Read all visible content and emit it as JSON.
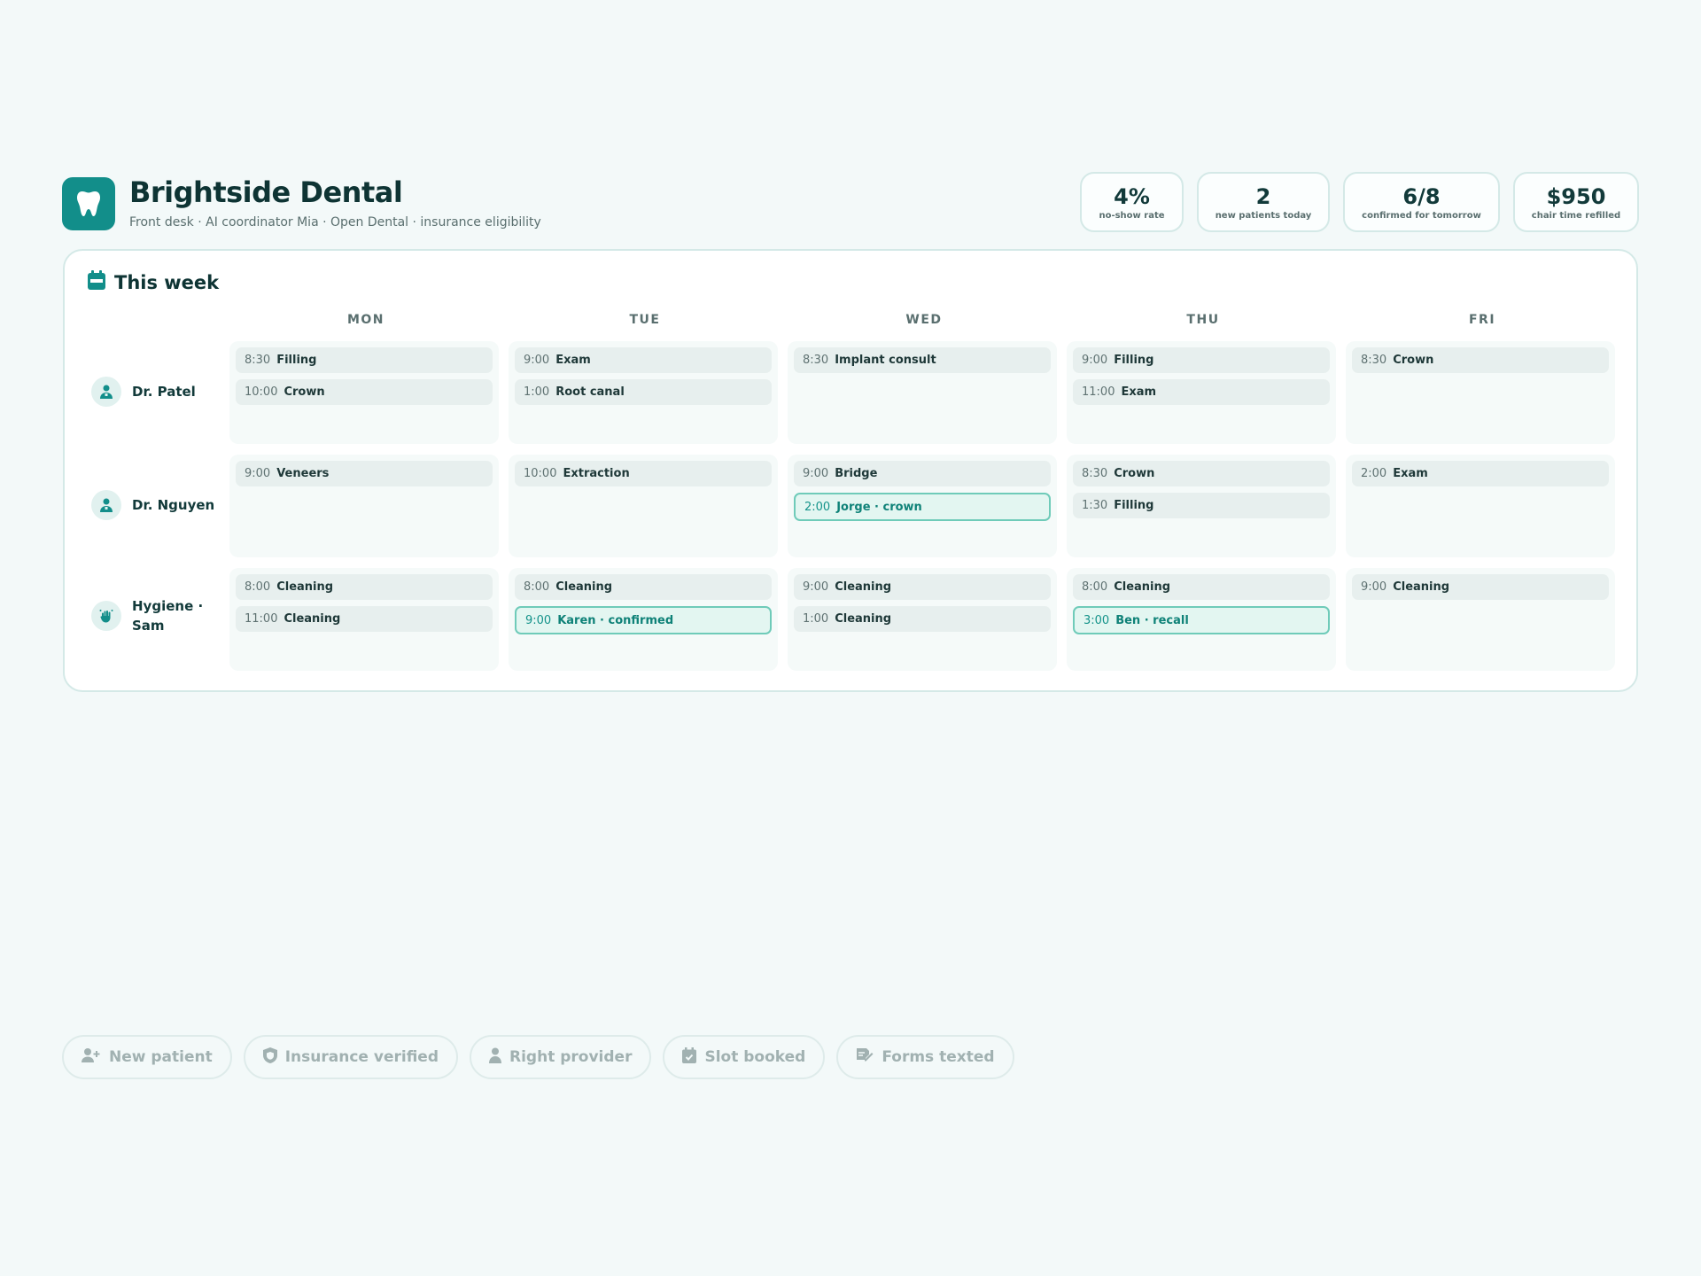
{
  "header": {
    "title": "Brightside Dental",
    "subtitle": "Front desk · AI coordinator Mia · Open Dental · insurance eligibility",
    "logo_icon": "tooth-icon"
  },
  "stats": [
    {
      "value": "4%",
      "label": "no-show rate"
    },
    {
      "value": "2",
      "label": "new patients today"
    },
    {
      "value": "6/8",
      "label": "confirmed for tomorrow"
    },
    {
      "value": "$950",
      "label": "chair time refilled"
    }
  ],
  "schedule": {
    "title": "This week",
    "title_icon": "calendar-icon",
    "days": [
      "MON",
      "TUE",
      "WED",
      "THU",
      "FRI"
    ],
    "providers": [
      {
        "name": "Dr. Patel",
        "icon": "dentist-icon",
        "days": [
          [
            {
              "time": "8:30",
              "what": "Filling"
            },
            {
              "time": "10:00",
              "what": "Crown"
            }
          ],
          [
            {
              "time": "9:00",
              "what": "Exam"
            },
            {
              "time": "1:00",
              "what": "Root canal"
            }
          ],
          [
            {
              "time": "8:30",
              "what": "Implant consult"
            }
          ],
          [
            {
              "time": "9:00",
              "what": "Filling"
            },
            {
              "time": "11:00",
              "what": "Exam"
            }
          ],
          [
            {
              "time": "8:30",
              "what": "Crown"
            }
          ]
        ]
      },
      {
        "name": "Dr. Nguyen",
        "icon": "dentist-icon",
        "days": [
          [
            {
              "time": "9:00",
              "what": "Veneers"
            }
          ],
          [
            {
              "time": "10:00",
              "what": "Extraction"
            }
          ],
          [
            {
              "time": "9:00",
              "what": "Bridge"
            },
            {
              "time": "2:00",
              "what": "Jorge · crown",
              "highlight": true
            }
          ],
          [
            {
              "time": "8:30",
              "what": "Crown"
            },
            {
              "time": "1:30",
              "what": "Filling"
            }
          ],
          [
            {
              "time": "2:00",
              "what": "Exam"
            }
          ]
        ]
      },
      {
        "name": "Hygiene · Sam",
        "icon": "hand-sparkle-icon",
        "days": [
          [
            {
              "time": "8:00",
              "what": "Cleaning"
            },
            {
              "time": "11:00",
              "what": "Cleaning"
            }
          ],
          [
            {
              "time": "8:00",
              "what": "Cleaning"
            },
            {
              "time": "9:00",
              "what": "Karen · confirmed",
              "highlight": true
            }
          ],
          [
            {
              "time": "9:00",
              "what": "Cleaning"
            },
            {
              "time": "1:00",
              "what": "Cleaning"
            }
          ],
          [
            {
              "time": "8:00",
              "what": "Cleaning"
            },
            {
              "time": "3:00",
              "what": "Ben · recall",
              "highlight": true
            }
          ],
          [
            {
              "time": "9:00",
              "what": "Cleaning"
            }
          ]
        ]
      }
    ]
  },
  "steps": [
    {
      "label": "New patient",
      "icon": "user-plus-icon"
    },
    {
      "label": "Insurance verified",
      "icon": "shield-icon"
    },
    {
      "label": "Right provider",
      "icon": "doctor-icon"
    },
    {
      "label": "Slot booked",
      "icon": "calendar-check-icon"
    },
    {
      "label": "Forms texted",
      "icon": "signature-icon"
    }
  ],
  "colors": {
    "accent": "#128e8a",
    "background": "#f3f9f9",
    "highlight_border": "#6fcbb9",
    "highlight_text": "#0f8278"
  }
}
